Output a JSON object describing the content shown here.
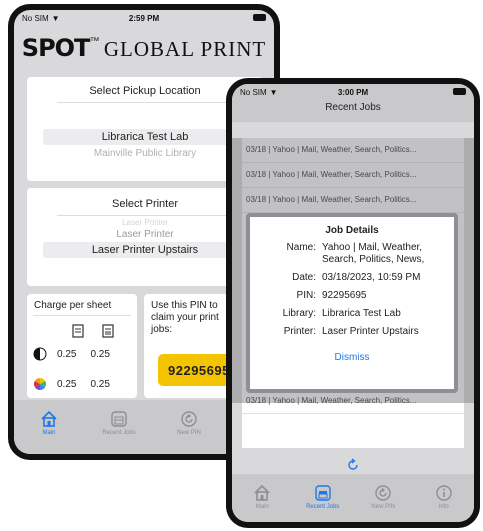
{
  "left_phone": {
    "status": {
      "carrier": "No SIM",
      "time": "2:59 PM"
    },
    "logo": {
      "spot": "SPOT",
      "tm": "™",
      "global_print": "GLOBAL PRINT"
    },
    "pickup": {
      "heading": "Select Pickup Location",
      "options": [
        "Librarica Test Lab",
        "Mainville Public Library"
      ]
    },
    "printer": {
      "heading": "Select Printer",
      "options": [
        "Laser Printer",
        "Laser Printer",
        "Laser Printer Upstairs"
      ]
    },
    "charge": {
      "heading": "Charge per sheet",
      "rows": [
        {
          "icon": "black-white-icon",
          "single": "0.25",
          "double": "0.25"
        },
        {
          "icon": "color-wheel-icon",
          "single": "0.25",
          "double": "0.25"
        }
      ]
    },
    "pin_box": {
      "text": "Use this PIN to claim your print jobs:",
      "pin": "92295695"
    },
    "tabs": [
      "Main",
      "Recent Jobs",
      "New PIN"
    ]
  },
  "right_phone": {
    "status": {
      "carrier": "No SIM",
      "time": "3:00 PM"
    },
    "title": "Recent Jobs",
    "jobs": [
      "03/18 | Yahoo | Mail, Weather, Search, Politics...",
      "03/18 | Yahoo | Mail, Weather, Search, Politics...",
      "03/18 | Yahoo | Mail, Weather, Search, Politics...",
      "03/18 | Yahoo | Mail, Weather, Search, Politics..."
    ],
    "details": {
      "title": "Job Details",
      "name_label": "Name:",
      "name_value": "Yahoo | Mail, Weather, Search, Politics, News, Fina...",
      "date_label": "Date:",
      "date_value": "03/18/2023, 10:59 PM",
      "pin_label": "PIN:",
      "pin_value": "92295695",
      "library_label": "Library:",
      "library_value": "Librarica Test Lab",
      "printer_label": "Printer:",
      "printer_value": "Laser Printer Upstairs",
      "dismiss": "Dismiss"
    },
    "tabs": [
      "Main",
      "Recent Jobs",
      "New PIN",
      "Info"
    ]
  },
  "colors": {
    "accent": "#1e78e6",
    "pin_yellow": "#f5c400",
    "tab_bg": "#c9c9cc"
  }
}
